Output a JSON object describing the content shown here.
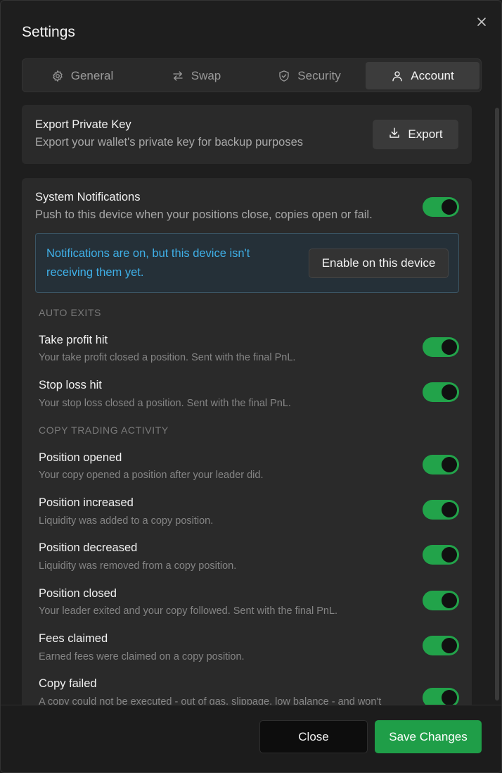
{
  "dialog": {
    "title": "Settings"
  },
  "tabs": [
    {
      "label": "General",
      "icon": "gear-icon"
    },
    {
      "label": "Swap",
      "icon": "swap-arrows-icon"
    },
    {
      "label": "Security",
      "icon": "shield-icon"
    },
    {
      "label": "Account",
      "icon": "user-icon",
      "active": true
    }
  ],
  "export_key": {
    "title": "Export Private Key",
    "description": "Export your wallet's private key for backup purposes",
    "button_label": "Export"
  },
  "system_notifications": {
    "title": "System Notifications",
    "description": "Push to this device when your positions close, copies open or fail.",
    "enabled": true,
    "banner_text": "Notifications are on, but this device isn't receiving them yet.",
    "banner_button": "Enable on this device"
  },
  "sections": {
    "auto_exits": "AUTO EXITS",
    "copy_trading": "COPY TRADING ACTIVITY"
  },
  "notifications": [
    {
      "title": "Take profit hit",
      "description": "Your take profit closed a position. Sent with the final PnL.",
      "enabled": true
    },
    {
      "title": "Stop loss hit",
      "description": "Your stop loss closed a position. Sent with the final PnL.",
      "enabled": true
    },
    {
      "title": "Position opened",
      "description": "Your copy opened a position after your leader did.",
      "enabled": true
    },
    {
      "title": "Position increased",
      "description": "Liquidity was added to a copy position.",
      "enabled": true
    },
    {
      "title": "Position decreased",
      "description": "Liquidity was removed from a copy position.",
      "enabled": true
    },
    {
      "title": "Position closed",
      "description": "Your leader exited and your copy followed. Sent with the final PnL.",
      "enabled": true
    },
    {
      "title": "Fees claimed",
      "description": "Earned fees were claimed on a copy position.",
      "enabled": true
    },
    {
      "title": "Copy failed",
      "description": "A copy could not be executed - out of gas, slippage, low balance - and won't",
      "enabled": true
    }
  ],
  "footer": {
    "close_label": "Close",
    "save_label": "Save Changes"
  },
  "colors": {
    "accent_green": "#22a34a",
    "save_green": "#1f9e48",
    "info_blue": "#3fb0e8",
    "background": "#1e1e1e",
    "card": "#2a2a2a"
  }
}
